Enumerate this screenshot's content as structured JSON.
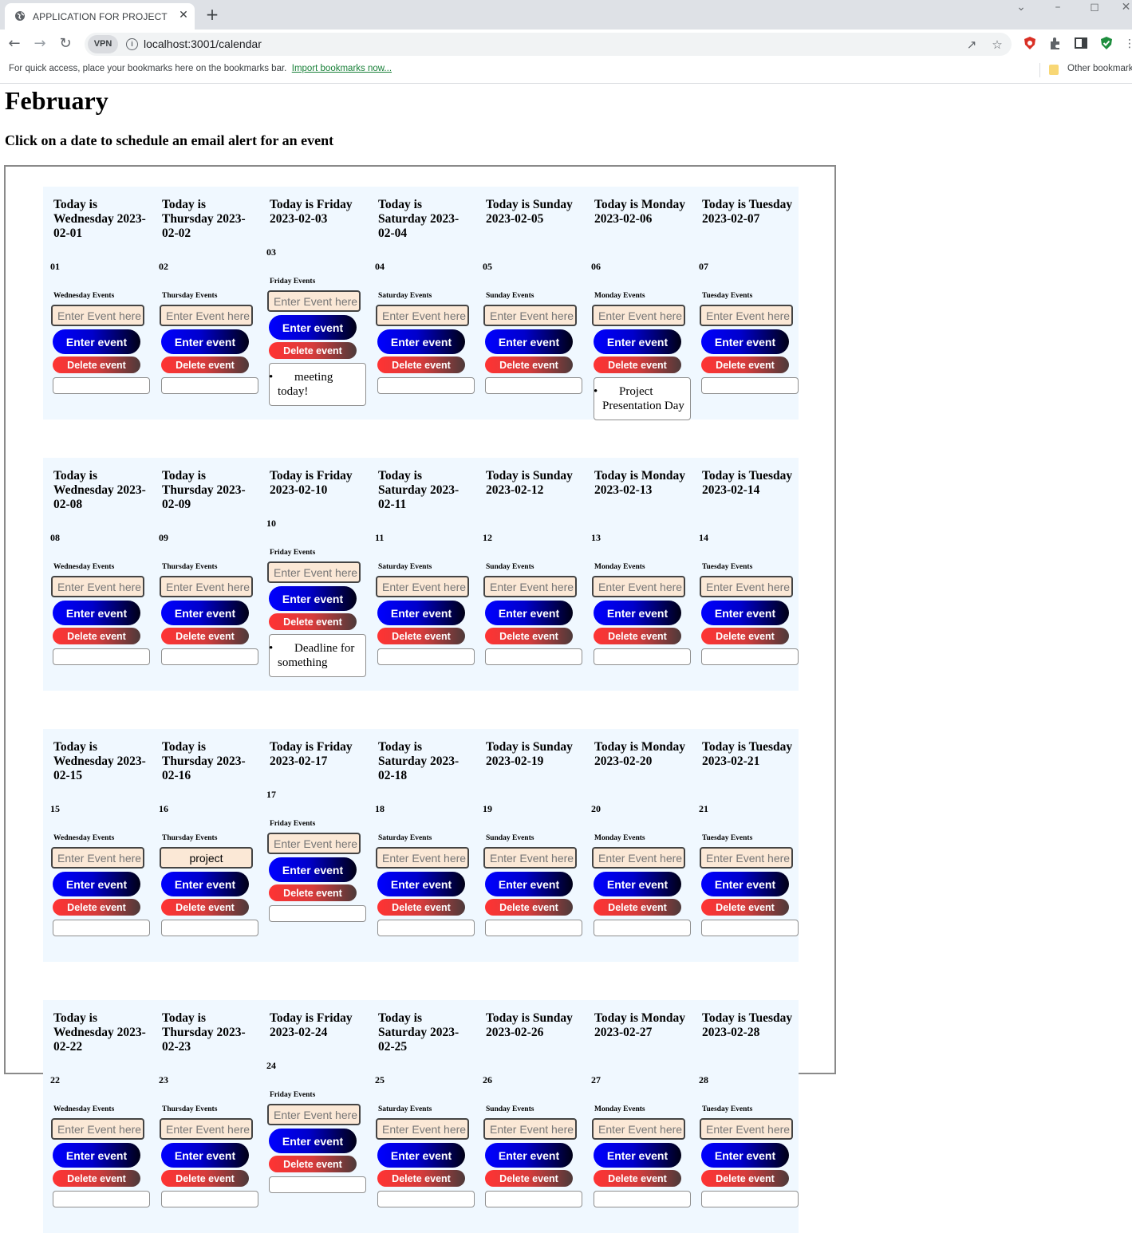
{
  "browser": {
    "tab_title": "APPLICATION FOR PROJECT",
    "tab_close": "✕",
    "new_tab": "+",
    "url": "localhost:3001/calendar",
    "vpn_label": "VPN",
    "bookmarks_hint": "For quick access, place your bookmarks here on the bookmarks bar.",
    "import_bookmarks": "Import bookmarks now...",
    "other_bookmarks": "Other bookmarks"
  },
  "page": {
    "title": "February",
    "subtitle": "Click on a date to schedule an email alert for an event"
  },
  "labels": {
    "input_placeholder": "Enter Event here",
    "enter_button": "Enter event",
    "delete_button": "Delete event"
  },
  "weeks": [
    {
      "days": [
        {
          "heading": "Today is Wednesday 2023-02-01",
          "num": "01",
          "events_label": "Wednesday Events",
          "input_value": "",
          "events": []
        },
        {
          "heading": "Today is Thursday 2023-02-02",
          "num": "02",
          "events_label": "Thursday Events",
          "input_value": "",
          "events": []
        },
        {
          "heading": "Today is Friday 2023-02-03",
          "num": "03",
          "events_label": "Friday Events",
          "input_value": "",
          "events": [
            "meeting today!"
          ]
        },
        {
          "heading": "Today is Saturday 2023-02-04",
          "num": "04",
          "events_label": "Saturday Events",
          "input_value": "",
          "events": []
        },
        {
          "heading": "Today is Sunday 2023-02-05",
          "num": "05",
          "events_label": "Sunday Events",
          "input_value": "",
          "events": []
        },
        {
          "heading": "Today is Monday 2023-02-06",
          "num": "06",
          "events_label": "Monday Events",
          "input_value": "",
          "events": [
            "Project Presentation Day"
          ]
        },
        {
          "heading": "Today is Tuesday 2023-02-07",
          "num": "07",
          "events_label": "Tuesday Events",
          "input_value": "",
          "events": []
        }
      ]
    },
    {
      "days": [
        {
          "heading": "Today is Wednesday 2023-02-08",
          "num": "08",
          "events_label": "Wednesday Events",
          "input_value": "",
          "events": []
        },
        {
          "heading": "Today is Thursday 2023-02-09",
          "num": "09",
          "events_label": "Thursday Events",
          "input_value": "",
          "events": []
        },
        {
          "heading": "Today is Friday 2023-02-10",
          "num": "10",
          "events_label": "Friday Events",
          "input_value": "",
          "events": [
            "Deadline for something"
          ]
        },
        {
          "heading": "Today is Saturday 2023-02-11",
          "num": "11",
          "events_label": "Saturday Events",
          "input_value": "",
          "events": []
        },
        {
          "heading": "Today is Sunday 2023-02-12",
          "num": "12",
          "events_label": "Sunday Events",
          "input_value": "",
          "events": []
        },
        {
          "heading": "Today is Monday 2023-02-13",
          "num": "13",
          "events_label": "Monday Events",
          "input_value": "",
          "events": []
        },
        {
          "heading": "Today is Tuesday 2023-02-14",
          "num": "14",
          "events_label": "Tuesday Events",
          "input_value": "",
          "events": []
        }
      ]
    },
    {
      "days": [
        {
          "heading": "Today is Wednesday 2023-02-15",
          "num": "15",
          "events_label": "Wednesday Events",
          "input_value": "",
          "events": []
        },
        {
          "heading": "Today is Thursday 2023-02-16",
          "num": "16",
          "events_label": "Thursday Events",
          "input_value": "project",
          "events": []
        },
        {
          "heading": "Today is Friday 2023-02-17",
          "num": "17",
          "events_label": "Friday Events",
          "input_value": "",
          "events": []
        },
        {
          "heading": "Today is Saturday 2023-02-18",
          "num": "18",
          "events_label": "Saturday Events",
          "input_value": "",
          "events": []
        },
        {
          "heading": "Today is Sunday 2023-02-19",
          "num": "19",
          "events_label": "Sunday Events",
          "input_value": "",
          "events": []
        },
        {
          "heading": "Today is Monday 2023-02-20",
          "num": "20",
          "events_label": "Monday Events",
          "input_value": "",
          "events": []
        },
        {
          "heading": "Today is Tuesday 2023-02-21",
          "num": "21",
          "events_label": "Tuesday Events",
          "input_value": "",
          "events": []
        }
      ]
    },
    {
      "days": [
        {
          "heading": "Today is Wednesday 2023-02-22",
          "num": "22",
          "events_label": "Wednesday Events",
          "input_value": "",
          "events": []
        },
        {
          "heading": "Today is Thursday 2023-02-23",
          "num": "23",
          "events_label": "Thursday Events",
          "input_value": "",
          "events": []
        },
        {
          "heading": "Today is Friday 2023-02-24",
          "num": "24",
          "events_label": "Friday Events",
          "input_value": "",
          "events": []
        },
        {
          "heading": "Today is Saturday 2023-02-25",
          "num": "25",
          "events_label": "Saturday Events",
          "input_value": "",
          "events": []
        },
        {
          "heading": "Today is Sunday 2023-02-26",
          "num": "26",
          "events_label": "Sunday Events",
          "input_value": "",
          "events": []
        },
        {
          "heading": "Today is Monday 2023-02-27",
          "num": "27",
          "events_label": "Monday Events",
          "input_value": "",
          "events": []
        },
        {
          "heading": "Today is Tuesday 2023-02-28",
          "num": "28",
          "events_label": "Tuesday Events",
          "input_value": "",
          "events": []
        }
      ]
    }
  ],
  "colors": {
    "week_background": "#f0f8ff",
    "input_background": "#fbe8d6",
    "enter_button": "#0000ff",
    "delete_button": "#ff3333"
  }
}
